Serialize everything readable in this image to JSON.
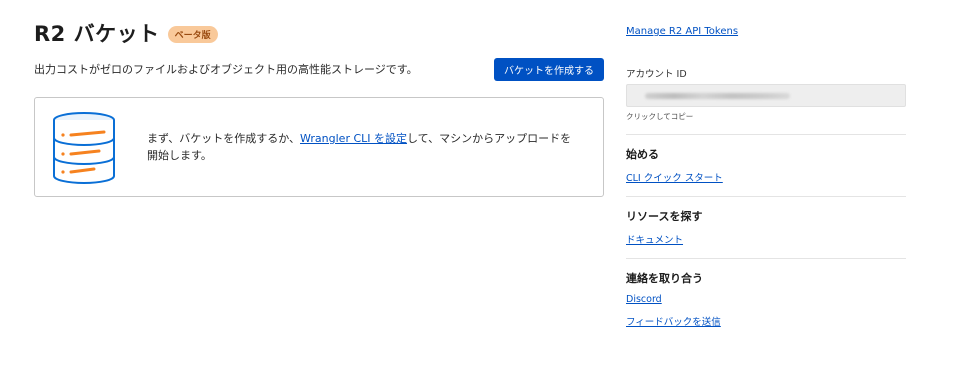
{
  "header": {
    "title": "R2 バケット",
    "badge": "ベータ版",
    "subtitle": "出力コストがゼロのファイルおよびオブジェクト用の高性能ストレージです。",
    "create_button": "バケットを作成する"
  },
  "card": {
    "text_before": "まず、バケットを作成するか、",
    "link_text": "Wrangler CLI を設定",
    "text_after": "して、マシンからアップロードを開始します。",
    "icon": "database-icon"
  },
  "sidebar": {
    "manage_tokens": "Manage R2 API Tokens",
    "account_id_label": "アカウント ID",
    "copy_hint": "クリックしてコピー",
    "sections": [
      {
        "heading": "始める",
        "links": [
          "CLI クイック スタート"
        ]
      },
      {
        "heading": "リソースを探す",
        "links": [
          "ドキュメント"
        ]
      },
      {
        "heading": "連絡を取り合う",
        "links": [
          "Discord",
          "フィードバックを送信"
        ]
      }
    ]
  },
  "colors": {
    "accent": "#0051c3",
    "badge_bg": "#f9c99a",
    "badge_text": "#9a4b10",
    "illustration_blue": "#0a6fd6",
    "illustration_orange": "#f6821f"
  }
}
